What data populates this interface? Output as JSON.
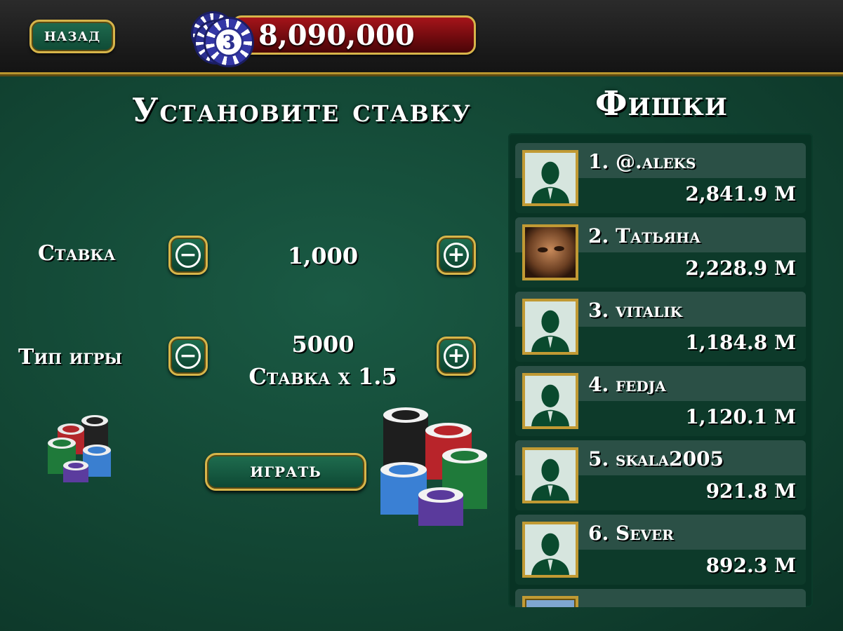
{
  "topbar": {
    "back_label": "НАЗАД",
    "level": "3",
    "balance": "8,090,000"
  },
  "bet_panel": {
    "title": "Установите ставку",
    "bet_label": "Ставка",
    "bet_value": "1,000",
    "game_type_label": "Тип игры",
    "game_type_value": "5000",
    "game_type_multiplier": "Ставка x 1.5",
    "play_label": "ИГРАТЬ",
    "minus_icon": "minus-icon",
    "plus_icon": "plus-icon"
  },
  "leaderboard": {
    "title": "Фишки",
    "rows": [
      {
        "rank": "1.",
        "name": "@.aleks",
        "score": "2,841.9 M",
        "avatar": "silhouette"
      },
      {
        "rank": "2.",
        "name": "Татьяна",
        "score": "2,228.9 M",
        "avatar": "photo"
      },
      {
        "rank": "3.",
        "name": "vitalik",
        "score": "1,184.8 M",
        "avatar": "silhouette"
      },
      {
        "rank": "4.",
        "name": "fedja",
        "score": "1,120.1 M",
        "avatar": "silhouette"
      },
      {
        "rank": "5.",
        "name": "skala2005",
        "score": "921.8 M",
        "avatar": "silhouette"
      },
      {
        "rank": "6.",
        "name": "Sever",
        "score": "892.3 M",
        "avatar": "silhouette"
      }
    ]
  },
  "colors": {
    "felt": "#124533",
    "gold_border": "#d7b54a",
    "balance_red": "#a5141a"
  }
}
